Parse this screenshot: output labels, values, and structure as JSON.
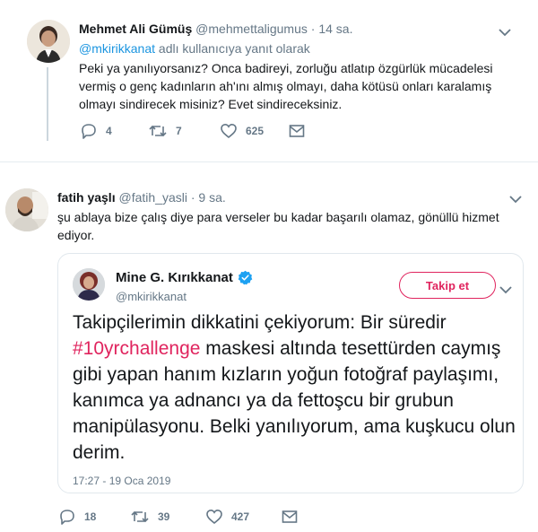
{
  "tweet1": {
    "name": "Mehmet Ali Gümüş",
    "handle": "@mehmettaligumus",
    "dot": "·",
    "time": "14 sa.",
    "reply_mention": "@mkirikkanat",
    "reply_suffix": " adlı kullanıcıya yanıt olarak",
    "text": "Peki ya yanılıyorsanız? Onca badireyi, zorluğu atlatıp özgürlük mücadelesi vermiş o genç kadınların ah'ını almış olmayı, daha kötüsü onları karalamış olmayı sindirecek misiniz? Evet sindireceksiniz.",
    "replies": "4",
    "retweets": "7",
    "likes": "625"
  },
  "tweet2": {
    "name": "fatih yaşlı",
    "handle": "@fatih_yasli",
    "dot": "·",
    "time": "9 sa.",
    "text": "şu ablaya bize çalış diye para verseler bu kadar başarılı olamaz, gönüllü hizmet ediyor.",
    "replies": "18",
    "retweets": "39",
    "likes": "427"
  },
  "quote": {
    "name": "Mine G. Kırıkkanat",
    "handle": "@mkirikkanat",
    "follow_label": "Takip et",
    "text_before": "Takipçilerimin dikkatini çekiyorum: Bir süredir ",
    "hashtag": "#10yrchallenge",
    "text_after": " maskesi altında tesettürden caymış gibi yapan  hanım kızların yoğun fotoğraf paylaşımı, kanımca ya adnancı ya da fettoşcu bir grubun manipülasyonu. Belki yanılıyorum, ama kuşkucu olun derim.",
    "date": "17:27 - 19 Oca 2019"
  },
  "icons": {
    "reply": "reply-icon",
    "retweet": "retweet-icon",
    "like": "heart-icon",
    "dm": "envelope-icon",
    "more": "chevron-down-icon",
    "verified": "verified-badge-icon"
  },
  "colors": {
    "text": "#14171a",
    "secondary": "#657786",
    "link": "#1b95e0",
    "hashtag": "#e0245e",
    "verified": "#1da1f2"
  }
}
